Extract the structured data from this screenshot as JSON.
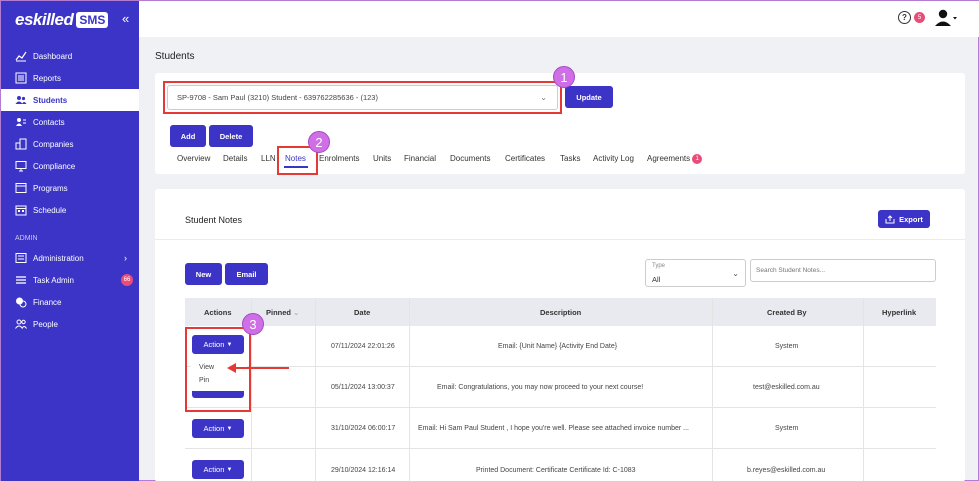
{
  "app": {
    "logo_text": "eskilled",
    "logo_badge": "SMS",
    "collapse_glyph": "«"
  },
  "sidebar": {
    "items": [
      {
        "label": "Dashboard",
        "icon": "chart-line-icon"
      },
      {
        "label": "Reports",
        "icon": "report-icon"
      },
      {
        "label": "Students",
        "icon": "users-icon",
        "active": true
      },
      {
        "label": "Contacts",
        "icon": "contact-card-icon"
      },
      {
        "label": "Companies",
        "icon": "building-icon"
      },
      {
        "label": "Compliance",
        "icon": "monitor-icon"
      },
      {
        "label": "Programs",
        "icon": "window-icon"
      },
      {
        "label": "Schedule",
        "icon": "calendar-icon"
      }
    ],
    "admin_section": "ADMIN",
    "admin_items": [
      {
        "label": "Administration",
        "icon": "settings-list-icon"
      },
      {
        "label": "Task Admin",
        "icon": "tasks-icon",
        "badge": "66"
      },
      {
        "label": "Finance",
        "icon": "coins-icon"
      },
      {
        "label": "People",
        "icon": "people-icon"
      }
    ]
  },
  "topbar": {
    "help_glyph": "?",
    "notification_count": "5"
  },
  "page": {
    "title": "Students"
  },
  "header": {
    "student_select": "SP-9708 - Sam Paul (3210) Student - 639762285636 - (123)",
    "update_label": "Update",
    "add_label": "Add",
    "delete_label": "Delete",
    "tabs": [
      "Overview",
      "Details",
      "LLN",
      "Notes",
      "Enrolments",
      "Units",
      "Financial",
      "Documents",
      "Certificates",
      "Tasks",
      "Activity Log",
      "Agreements"
    ],
    "active_tab": "Notes",
    "agreements_badge": "1"
  },
  "callouts": [
    "1",
    "2",
    "3"
  ],
  "notes": {
    "title": "Student Notes",
    "export_label": "Export",
    "new_label": "New",
    "email_label": "Email",
    "type_label": "Type",
    "type_value": "All",
    "search_placeholder": "Search Student Notes...",
    "columns": [
      "Actions",
      "Pinned",
      "Date",
      "Description",
      "Created By",
      "Hyperlink"
    ],
    "action_label": "Action",
    "dropdown": [
      "View",
      "Pin"
    ],
    "rows": [
      {
        "date": "07/11/2024 22:01:26",
        "description": "Email: {Unit Name} {Activity End Date}",
        "created_by": "System"
      },
      {
        "date": "05/11/2024 13:00:37",
        "description": "Email: Congratulations, you may now proceed to your next course!",
        "created_by": "test@eskilled.com.au"
      },
      {
        "date": "31/10/2024 06:00:17",
        "description": "Email: Hi  Sam Paul Student , I hope you're well. Please see attached invoice number ...",
        "created_by": "System"
      },
      {
        "date": "29/10/2024 12:16:14",
        "description": "Printed Document: Certificate Certificate Id: C-1083",
        "created_by": "b.reyes@eskilled.com.au"
      }
    ]
  },
  "colors": {
    "primary": "#3b34c7",
    "badge": "#e84d7a",
    "highlight": "#e53935",
    "callout": "#d06ee8"
  }
}
